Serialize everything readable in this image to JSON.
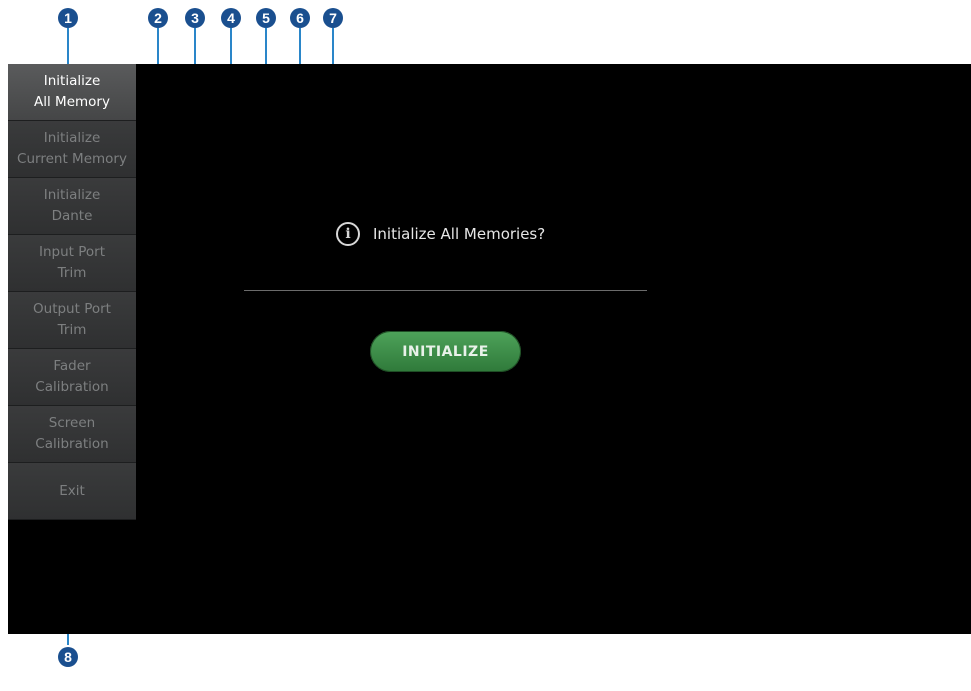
{
  "callouts": [
    "1",
    "2",
    "3",
    "4",
    "5",
    "6",
    "7",
    "8"
  ],
  "sidebar": {
    "items": [
      {
        "label": "Initialize\nAll Memory",
        "active": true
      },
      {
        "label": "Initialize\nCurrent Memory",
        "active": false
      },
      {
        "label": "Initialize\nDante",
        "active": false
      },
      {
        "label": "Input Port\nTrim",
        "active": false
      },
      {
        "label": "Output Port\nTrim",
        "active": false
      },
      {
        "label": "Fader\nCalibration",
        "active": false
      },
      {
        "label": "Screen\nCalibration",
        "active": false
      },
      {
        "label": "Exit",
        "active": false
      }
    ]
  },
  "dialog": {
    "icon": "info-icon",
    "message": "Initialize All Memories?",
    "button_label": "INITIALIZE"
  },
  "colors": {
    "accent_green": "#3f9149",
    "callout_blue": "#1a4f8f",
    "leader_blue": "#2a86c9"
  }
}
